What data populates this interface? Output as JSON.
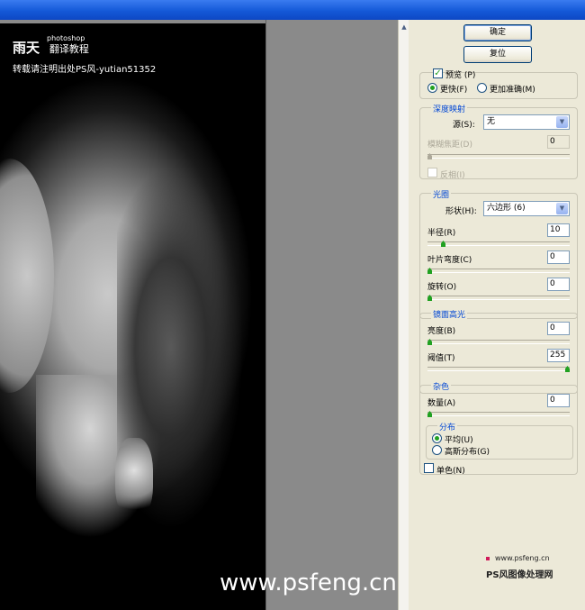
{
  "preview": {
    "brand_title": "雨天",
    "brand_small": "photoshop",
    "brand_sub": "翻译教程",
    "brand_line2": "转载请注明出处PS风-yutian51352",
    "watermark": "www.psfeng.cn"
  },
  "buttons": {
    "ok": "确定",
    "reset": "复位"
  },
  "preview_opts": {
    "preview_label": "预览",
    "preview_key": "(P)",
    "faster_label": "更快",
    "faster_key": "(F)",
    "accurate_label": "更加准确",
    "accurate_key": "(M)"
  },
  "depth_map": {
    "legend": "深度映射",
    "source_label": "源(S):",
    "source_value": "无",
    "blur_focal_label": "模糊焦距(D)",
    "blur_focal_value": "0",
    "invert_label": "反相(I)"
  },
  "iris": {
    "legend": "光圈",
    "shape_label": "形状(H):",
    "shape_value": "六边形 (6)",
    "radius_label": "半径(R)",
    "radius_value": "10",
    "blade_label": "叶片弯度(C)",
    "blade_value": "0",
    "rotation_label": "旋转(O)",
    "rotation_value": "0"
  },
  "specular": {
    "legend": "镜面高光",
    "brightness_label": "亮度(B)",
    "brightness_value": "0",
    "threshold_label": "阈值(T)",
    "threshold_value": "255"
  },
  "noise": {
    "legend": "杂色",
    "amount_label": "数量(A)",
    "amount_value": "0",
    "distribution_legend": "分布",
    "uniform_label": "平均(U)",
    "gaussian_label": "高斯分布(G)",
    "mono_label": "单色(N)"
  },
  "site_logo": {
    "url": "www.psfeng.cn",
    "name": "PS风图像处理网"
  },
  "sliders": {
    "blur_focal": 0,
    "radius": 0.1,
    "blade": 0,
    "rotation": 0,
    "brightness": 0,
    "threshold": 1.0,
    "amount": 0
  },
  "colors": {
    "accent_green": "#21a121",
    "legend_blue": "#0046d5",
    "titlebar_blue": "#1459d8"
  }
}
